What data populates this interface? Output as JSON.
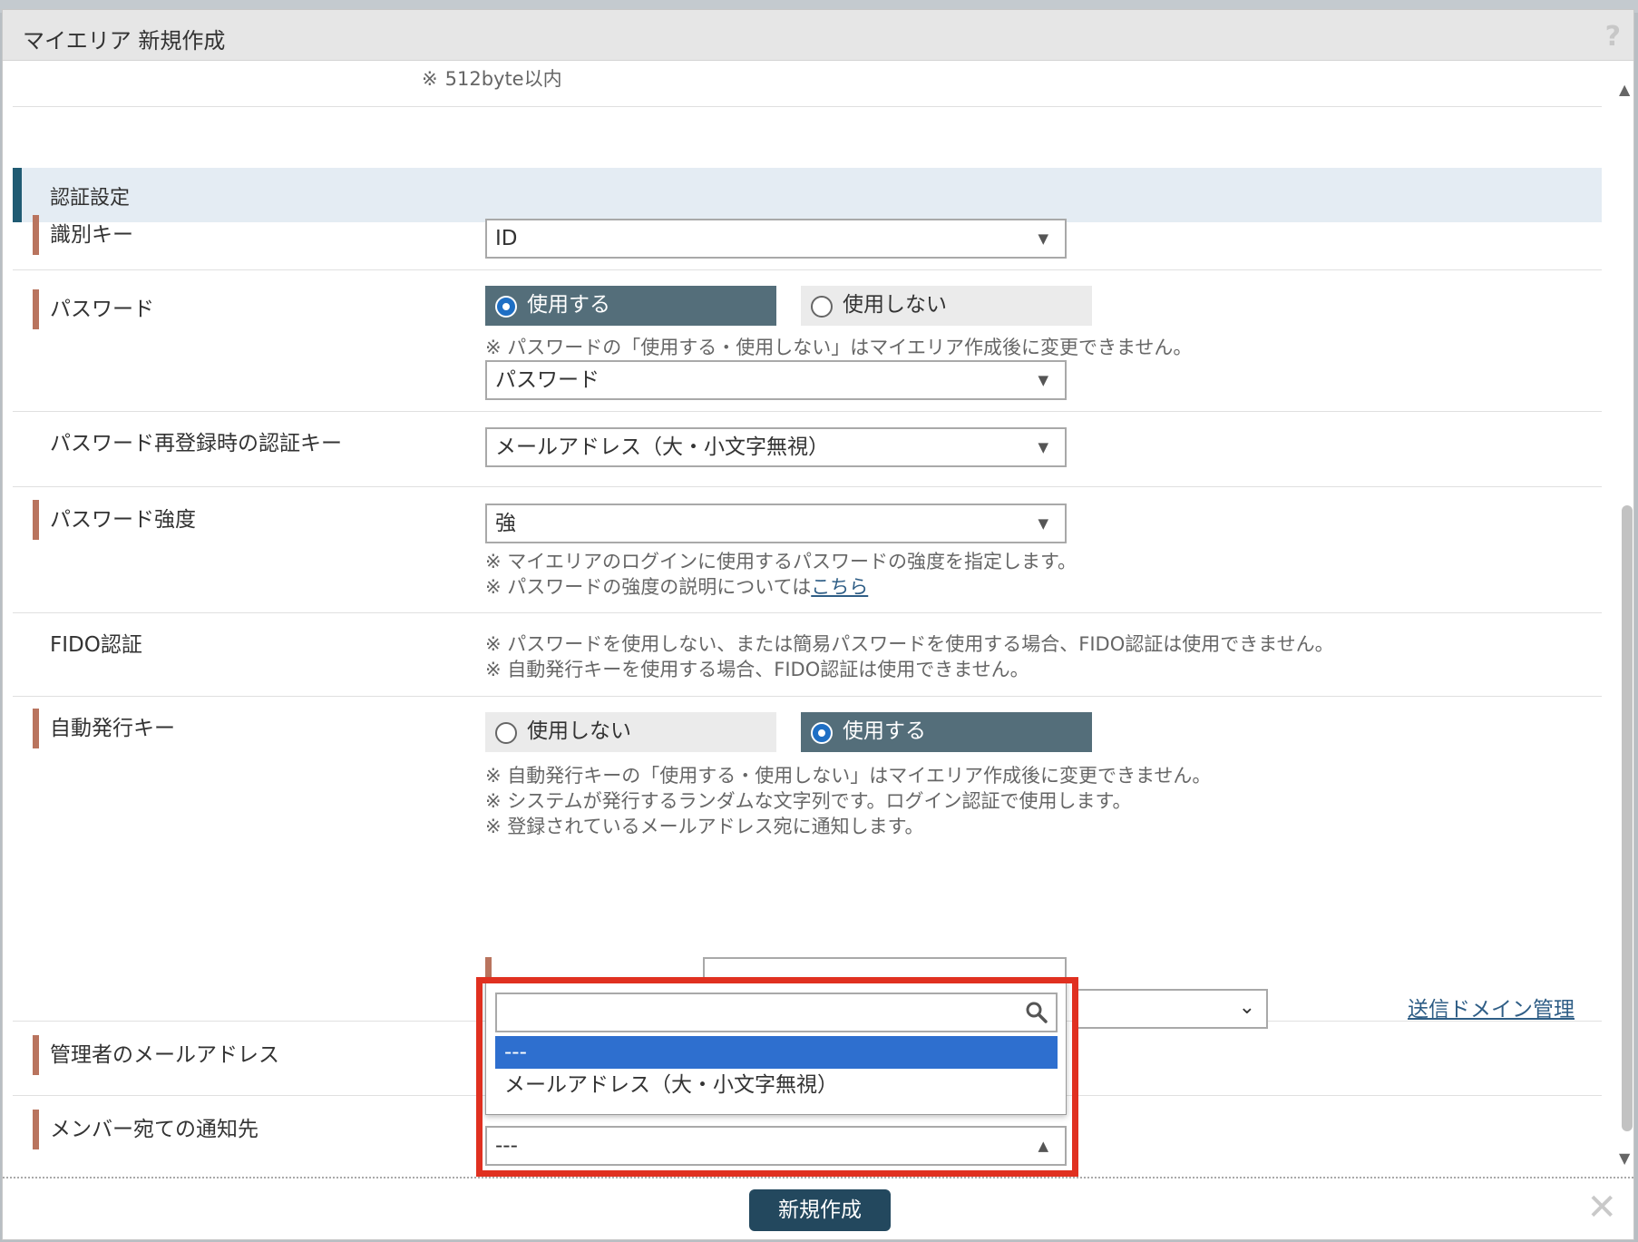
{
  "dialog": {
    "title": "マイエリア 新規作成",
    "help_icon": "?",
    "close_icon": "✕"
  },
  "top_note": {
    "mark": "※",
    "text": "512byte以内"
  },
  "section": {
    "title": "認証設定"
  },
  "rows": {
    "id_key": {
      "label": "識別キー",
      "value": "ID"
    },
    "password": {
      "label": "パスワード",
      "option_use": "使用する",
      "option_not_use": "使用しない",
      "selected": "使用する",
      "note": "※ パスワードの「使用する・使用しない」はマイエリア作成後に変更できません。",
      "value": "パスワード"
    },
    "reregister": {
      "label": "パスワード再登録時の認証キー",
      "value": "メールアドレス（大・小文字無視）"
    },
    "strength": {
      "label": "パスワード強度",
      "value": "強",
      "note1": "※ マイエリアのログインに使用するパスワードの強度を指定します。",
      "note2_prefix": "※ パスワードの強度の説明については",
      "note2_link": "こちら"
    },
    "fido": {
      "label": "FIDO認証",
      "note1": "※ パスワードを使用しない、または簡易パスワードを使用する場合、FIDO認証は使用できません。",
      "note2": "※ 自動発行キーを使用する場合、FIDO認証は使用できません。"
    },
    "auto_key": {
      "label": "自動発行キー",
      "option_not_use": "使用しない",
      "option_use": "使用する",
      "selected": "使用する",
      "note1": "※ 自動発行キーの「使用する・使用しない」はマイエリア作成後に変更できません。",
      "note2": "※ システムが発行するランダムな文字列です。ログイン認証で使用します。",
      "note3": "※ 登録されているメールアドレス宛に通知します。"
    },
    "admin_email": {
      "label": "管理者のメールアドレス",
      "link": "送信ドメイン管理"
    },
    "member_notify": {
      "label": "メンバー宛ての通知先",
      "value": "---"
    }
  },
  "dropdown": {
    "search_placeholder": "",
    "options": [
      "---",
      "メールアドレス（大・小文字無視）"
    ],
    "highlighted": "---"
  },
  "footer": {
    "create_label": "新規作成"
  },
  "colors": {
    "accent": "#205b73",
    "required_bar": "#b9745e",
    "radio_on_bg": "#546e7a",
    "option_highlight": "#2e6fcf",
    "callout": "#e03020",
    "button": "#23485e"
  }
}
